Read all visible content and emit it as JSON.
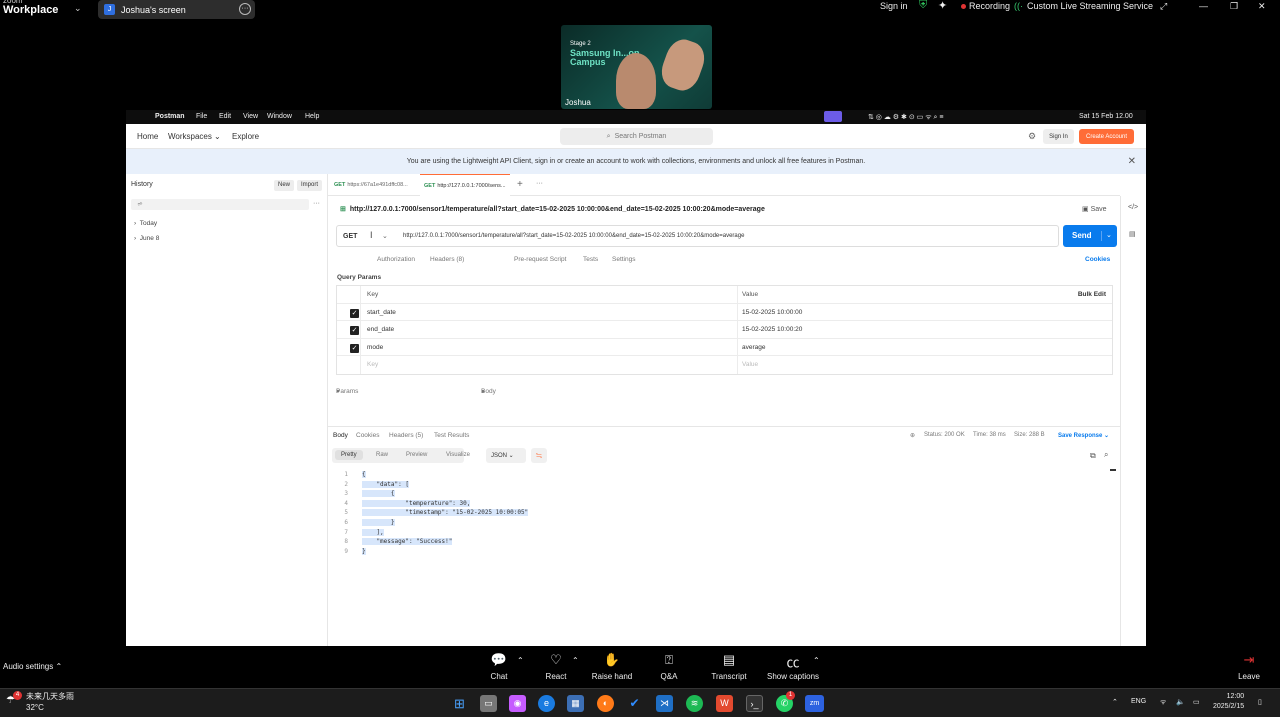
{
  "zoom": {
    "logo_top": "zoom",
    "logo_bottom": "Workplace",
    "shared_screen_label": "Joshua's screen",
    "shared_screen_initial": "J",
    "sign_in": "Sign in",
    "recording": "Recording",
    "live_streaming": "Custom Live Streaming Service",
    "video": {
      "stage": "Stage 2",
      "title": "Samsung In...on Campus",
      "participant_name": "Joshua"
    },
    "bottom": {
      "audio_settings": "Audio settings",
      "chat": "Chat",
      "react": "React",
      "raise_hand": "Raise hand",
      "qa": "Q&A",
      "transcript": "Transcript",
      "show_captions": "Show captions",
      "leave": "Leave"
    }
  },
  "mac_menubar": {
    "app": "Postman",
    "menus": [
      "File",
      "Edit",
      "View",
      "Window",
      "Help"
    ],
    "datetime": "Sat 15 Feb 12.00"
  },
  "postman": {
    "nav": {
      "home": "Home",
      "workspaces": "Workspaces",
      "explore": "Explore"
    },
    "search_placeholder": "Search Postman",
    "sign_in": "Sign In",
    "create_account": "Create Account",
    "banner": "You are using the Lightweight API Client, sign in or create an account to work with collections, environments and unlock all free features in Postman.",
    "sidebar": {
      "title": "History",
      "new": "New",
      "import": "Import",
      "groups": [
        "Today",
        "June 8"
      ]
    },
    "tabs": [
      {
        "method": "GET",
        "label": "https://67a1e491dffc08..."
      },
      {
        "method": "GET",
        "label": "http://127.0.0.1:7000/sens..."
      }
    ],
    "request": {
      "title": "http://127.0.0.1:7000/sensor1/temperature/all?start_date=15-02-2025 10:00:00&end_date=15-02-2025 10:00:20&mode=average",
      "save": "Save",
      "method": "GET",
      "url": "http://127.0.0.1:7000/sensor1/temperature/all?start_date=15-02-2025 10:00:00&end_date=15-02-2025 10:00:20&mode=average",
      "send": "Send",
      "subtabs": [
        "Params",
        "Authorization",
        "Headers (8)",
        "Body",
        "Pre-request Script",
        "Tests",
        "Settings"
      ],
      "cookies": "Cookies",
      "query_params_title": "Query Params",
      "columns": {
        "key": "Key",
        "value": "Value",
        "bulk_edit": "Bulk Edit"
      },
      "params": [
        {
          "key": "start_date",
          "value": "15-02-2025 10:00:00"
        },
        {
          "key": "end_date",
          "value": "15-02-2025 10:00:20"
        },
        {
          "key": "mode",
          "value": "average"
        }
      ],
      "placeholder_key": "Key",
      "placeholder_value": "Value"
    },
    "response": {
      "tabs": [
        "Body",
        "Cookies",
        "Headers (5)",
        "Test Results"
      ],
      "status": "Status: 200 OK",
      "time": "Time: 38 ms",
      "size": "Size: 288 B",
      "save_response": "Save Response",
      "view_modes": [
        "Pretty",
        "Raw",
        "Preview",
        "Visualize"
      ],
      "format": "JSON",
      "body_lines": [
        "{",
        "    \"data\": [",
        "        {",
        "            \"temperature\": 30,",
        "            \"timestamp\": \"15-02-2025 10:00:05\"",
        "        }",
        "    ],",
        "    \"message\": \"Success!\"",
        "}"
      ]
    }
  },
  "taskbar": {
    "weather_text": "未来几天多雨",
    "temperature": "32°C",
    "language": "ENG",
    "time": "12:00",
    "date": "2025/2/15",
    "weather_badge": "4",
    "whatsapp_badge": "1"
  }
}
